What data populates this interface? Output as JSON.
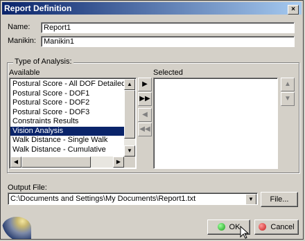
{
  "window": {
    "title": "Report Definition",
    "close_glyph": "×"
  },
  "form": {
    "name_label": "Name:",
    "name_value": "Report1",
    "manikin_label": "Manikin:",
    "manikin_value": "Manikin1"
  },
  "analysis": {
    "group_title": "Type of Analysis:",
    "available_label": "Available",
    "selected_label": "Selected",
    "available_items": [
      "Postural Score - All DOF Detailed",
      "Postural Score - DOF1",
      "Postural Score - DOF2",
      "Postural Score - DOF3",
      "Constraints Results",
      "Vision Analysis",
      "Walk Distance - Single Walk",
      "Walk Distance - Cumulative"
    ],
    "selected_index": 5,
    "selected_items": []
  },
  "output": {
    "label": "Output File:",
    "value": "C:\\Documents and Settings\\My Documents\\Report1.txt",
    "file_button": "File..."
  },
  "buttons": {
    "ok": "OK",
    "cancel": "Cancel"
  },
  "colors": {
    "title_bar": "#0a246a",
    "selection": "#0a246a",
    "ok_icon": "#22aa22",
    "cancel_icon": "#cc2222"
  }
}
